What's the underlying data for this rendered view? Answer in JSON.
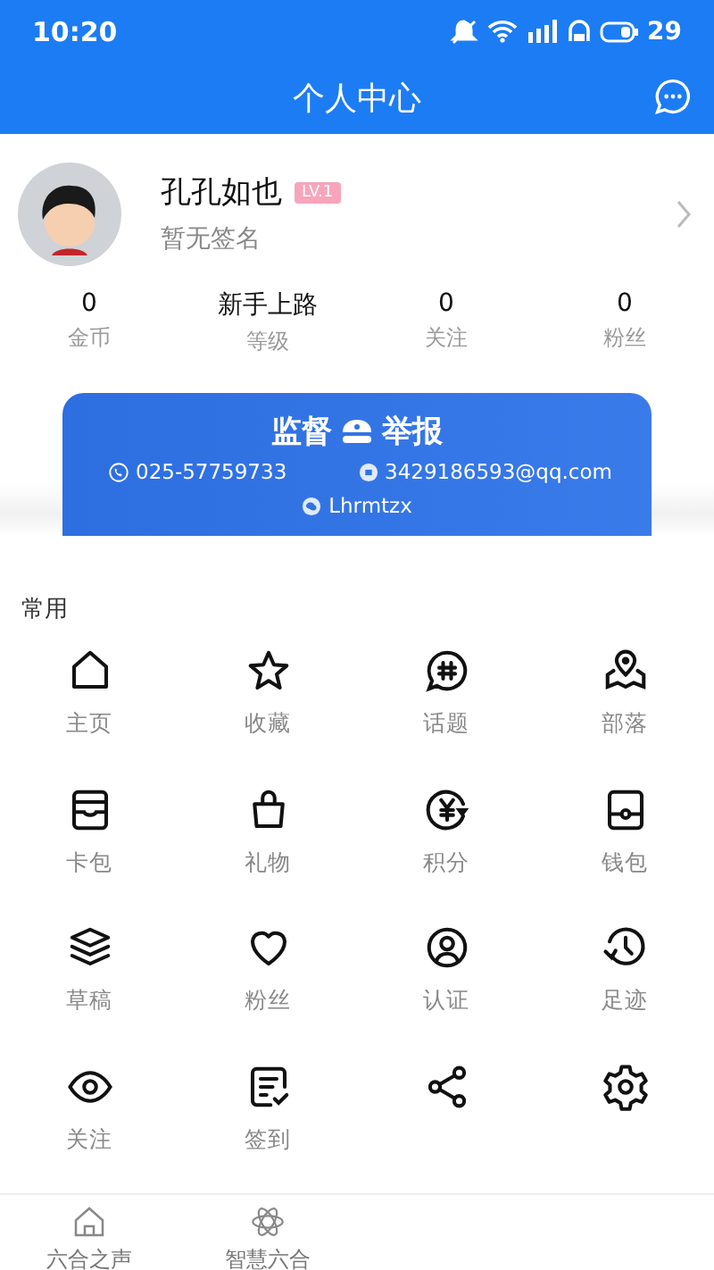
{
  "status_bar": {
    "time": "10:20",
    "battery": "29"
  },
  "header": {
    "title": "个人中心"
  },
  "profile": {
    "name": "孔孔如也",
    "level_badge": "LV.1",
    "signature": "暂无签名"
  },
  "stats": [
    {
      "value": "0",
      "label": "金币"
    },
    {
      "value": "新手上路",
      "label": "等级"
    },
    {
      "value": "0",
      "label": "关注"
    },
    {
      "value": "0",
      "label": "粉丝"
    }
  ],
  "banner": {
    "title_left": "监督",
    "title_right": "举报",
    "contacts": [
      {
        "kind": "phone",
        "text": "025-57759733"
      },
      {
        "kind": "email",
        "text": "3429186593@qq.com"
      },
      {
        "kind": "wechat",
        "text": "Lhrmtzx"
      }
    ]
  },
  "section": {
    "title": "常用"
  },
  "grid": [
    {
      "kind": "labeled",
      "label": "主页"
    },
    {
      "kind": "labeled",
      "label": "收藏"
    },
    {
      "kind": "labeled",
      "label": "话题"
    },
    {
      "kind": "labeled",
      "label": "部落"
    },
    {
      "kind": "labeled",
      "label": "卡包"
    },
    {
      "kind": "labeled",
      "label": "礼物"
    },
    {
      "kind": "labeled",
      "label": "积分"
    },
    {
      "kind": "labeled",
      "label": "钱包"
    },
    {
      "kind": "labeled",
      "label": "草稿"
    },
    {
      "kind": "labeled",
      "label": "粉丝"
    },
    {
      "kind": "labeled",
      "label": "认证"
    },
    {
      "kind": "labeled",
      "label": "足迹"
    },
    {
      "kind": "labeled",
      "label": "关注"
    },
    {
      "kind": "labeled",
      "label": "签到"
    },
    {
      "kind": "icon"
    },
    {
      "kind": "icon"
    }
  ],
  "bottom_nav": [
    {
      "label": "六合之声"
    },
    {
      "label": "智慧六合"
    }
  ]
}
